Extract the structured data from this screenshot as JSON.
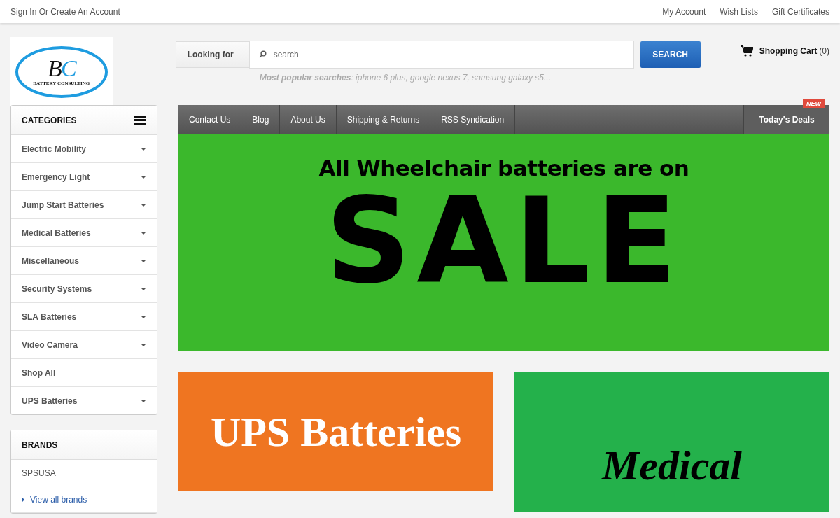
{
  "top_bar": {
    "sign_in": "Sign In Or Create An Account",
    "links": [
      "My Account",
      "Wish Lists",
      "Gift Certificates"
    ]
  },
  "logo": {
    "initials": [
      "B",
      "C"
    ],
    "name": "BATTERY CONSULTING"
  },
  "search": {
    "label": "Looking for",
    "placeholder": "search",
    "button": "SEARCH",
    "popular_label": "Most popular searches",
    "popular": ": iphone 6 plus, google nexus 7, samsung galaxy s5..."
  },
  "cart": {
    "label": "Shopping Cart",
    "count": "(0)"
  },
  "categories": {
    "title": "CATEGORIES",
    "items": [
      {
        "label": "Electric Mobility",
        "has_children": true
      },
      {
        "label": "Emergency Light",
        "has_children": true
      },
      {
        "label": "Jump Start Batteries",
        "has_children": true
      },
      {
        "label": "Medical Batteries",
        "has_children": true
      },
      {
        "label": "Miscellaneous",
        "has_children": true
      },
      {
        "label": "Security Systems",
        "has_children": true
      },
      {
        "label": "SLA Batteries",
        "has_children": true
      },
      {
        "label": "Video Camera",
        "has_children": true
      },
      {
        "label": "Shop All",
        "has_children": false
      },
      {
        "label": "UPS Batteries",
        "has_children": true
      }
    ]
  },
  "brands": {
    "title": "BRANDS",
    "items": [
      "SPSUSA"
    ],
    "view_all": "View all brands"
  },
  "nav": {
    "items": [
      "Contact Us",
      "Blog",
      "About Us",
      "Shipping & Returns",
      "RSS Syndication"
    ],
    "deals": "Today's Deals",
    "deals_badge": "NEW"
  },
  "hero": {
    "line": "All Wheelchair batteries are on",
    "big": "SALE"
  },
  "tiles": [
    {
      "text": "UPS Batteries",
      "color": "#ef7521"
    },
    {
      "text": "Medical",
      "color": "#24b14b"
    }
  ]
}
